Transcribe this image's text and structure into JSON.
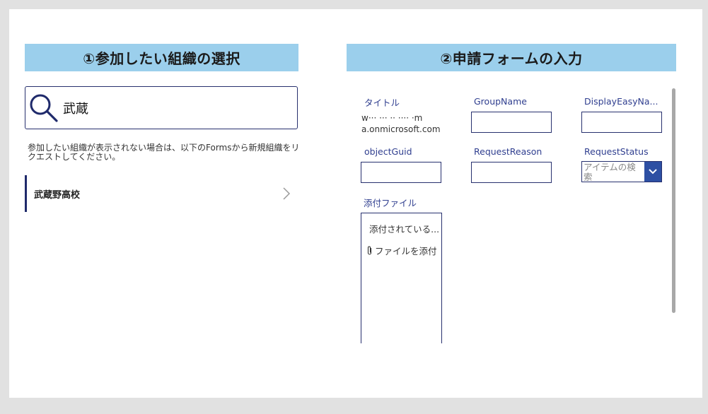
{
  "left_panel": {
    "header": "①参加したい組織の選択",
    "search": {
      "value": "武蔵",
      "icon": "search-icon"
    },
    "hint": "参加したい組織が表示されない場合は、以下のFormsから新規組織をリクエストしてください。",
    "organizations": [
      {
        "name": "武蔵野高校",
        "icon": "chevron-right-icon"
      }
    ]
  },
  "right_panel": {
    "header": "②申請フォームの入力",
    "fields": {
      "title": {
        "label": "タイトル",
        "value_line1": "w··· ··· ·· ···· ·m",
        "value_line2": "a.onmicrosoft.com"
      },
      "group_name": {
        "label": "GroupName",
        "value": ""
      },
      "display_easy_name": {
        "label": "DisplayEasyNa...",
        "value": ""
      },
      "object_guid": {
        "label": "objectGuid",
        "value": ""
      },
      "request_reason": {
        "label": "RequestReason",
        "value": ""
      },
      "request_status": {
        "label": "RequestStatus",
        "placeholder": "アイテムの検索"
      },
      "attachments": {
        "label": "添付ファイル",
        "empty_text": "添付されている...",
        "add_label": "ファイルを添付"
      }
    }
  },
  "colors": {
    "header_bg": "#9bcfec",
    "border": "#27306e",
    "label": "#2f3e8f",
    "dropdown_btn": "#2d4fa3"
  }
}
